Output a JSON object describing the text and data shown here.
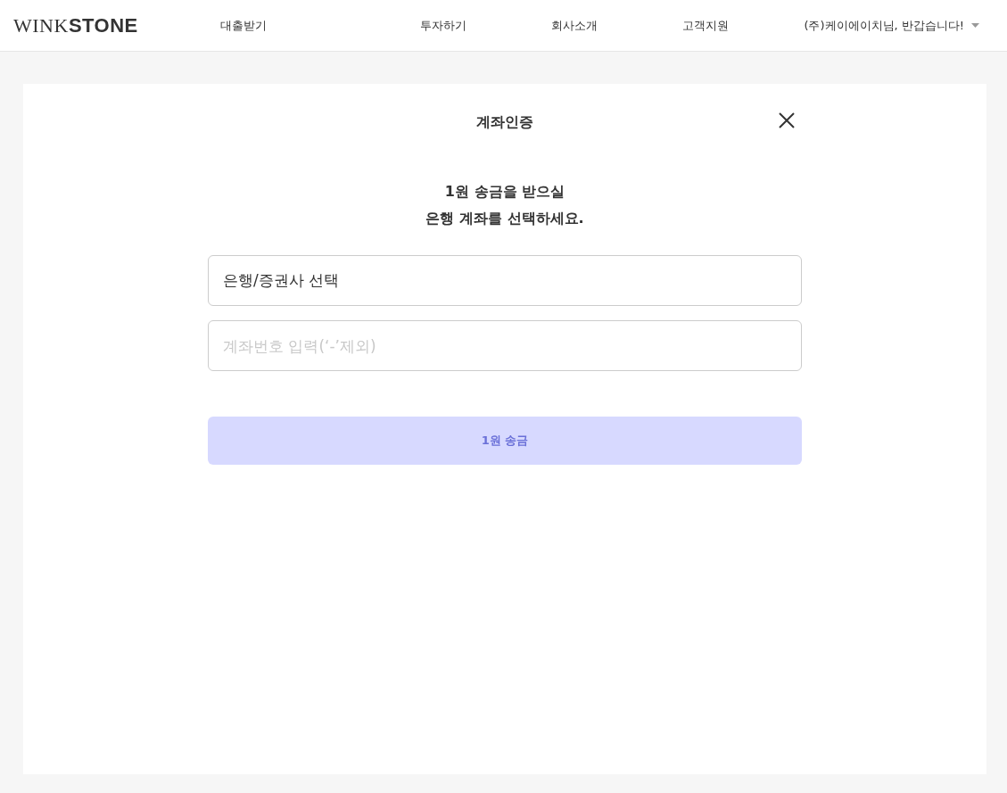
{
  "header": {
    "logo": "WINK**STONE**",
    "nav": [
      "대출받기",
      "투자하기",
      "회사소개",
      "고객지원"
    ],
    "user_menu": "(주)케이에이치님, 반갑습니다!"
  },
  "dialog": {
    "title": "계좌인증",
    "message_lines": [
      "1원 송금을 받으실",
      "은행 계좌를 선택하세요."
    ],
    "bank_select": {
      "value": "은행/증권사 선택"
    },
    "account_field": {
      "placeholder": "계좌번호 입력(‘-’제외)"
    },
    "submit": {
      "label": "1원 송금",
      "disabled": true
    }
  }
}
